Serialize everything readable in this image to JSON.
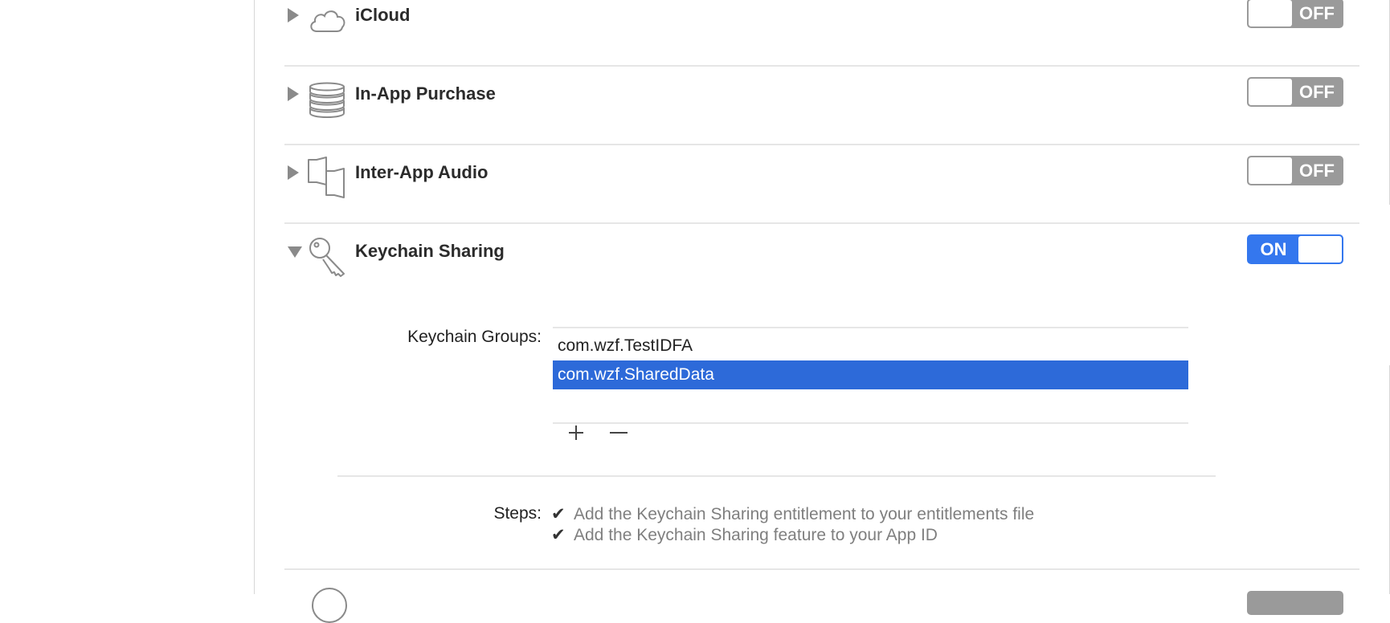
{
  "capabilities": [
    {
      "label": "iCloud",
      "icon": "cloud-icon",
      "state": "OFF",
      "expanded": false
    },
    {
      "label": "In-App Purchase",
      "icon": "coin-stack-icon",
      "state": "OFF",
      "expanded": false
    },
    {
      "label": "Inter-App Audio",
      "icon": "speaker-icon",
      "state": "OFF",
      "expanded": false
    },
    {
      "label": "Keychain Sharing",
      "icon": "key-icon",
      "state": "ON",
      "expanded": true
    }
  ],
  "keychain": {
    "groups_label": "Keychain Groups:",
    "groups": [
      "com.wzf.TestIDFA",
      "com.wzf.SharedData"
    ],
    "selected_index": 1,
    "add_symbol": "+",
    "remove_symbol": "−",
    "steps_label": "Steps:",
    "steps": [
      {
        "check": "✔",
        "text": "Add the Keychain Sharing entitlement to your entitlements file"
      },
      {
        "check": "✔",
        "text": "Add the Keychain Sharing feature to your App ID"
      }
    ]
  },
  "colors": {
    "toggle_on": "#3477ee",
    "toggle_off": "#9a9a9a",
    "selection": "#2d6ad9",
    "icon_stroke": "#8a8a8a"
  }
}
